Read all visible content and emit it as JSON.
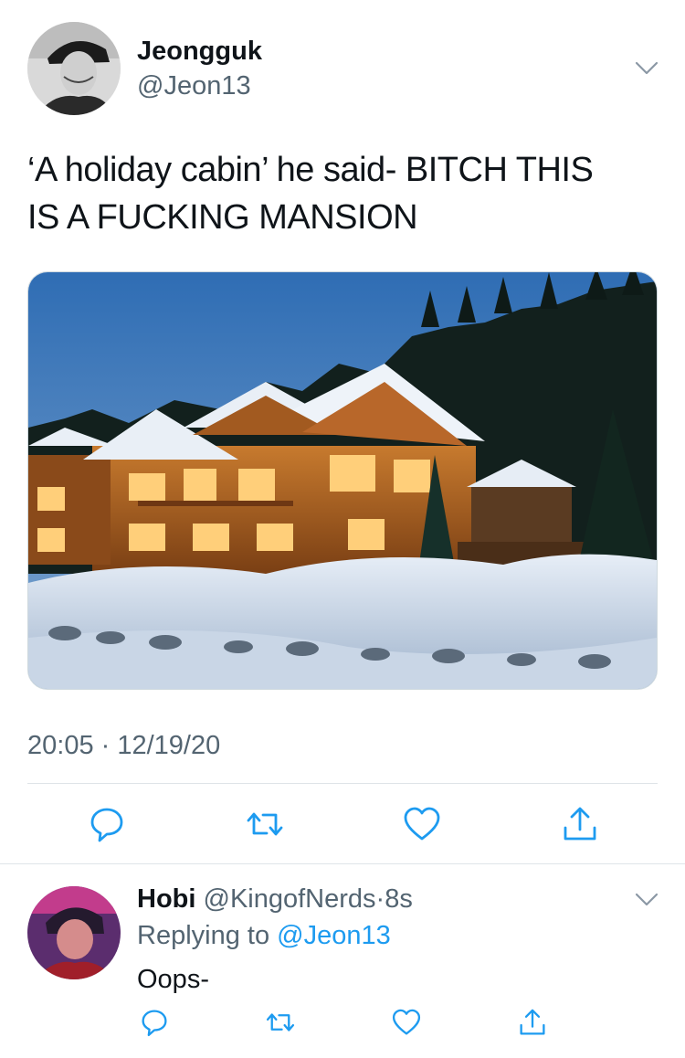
{
  "tweet": {
    "author_name": "Jeongguk",
    "author_handle": "@Jeon13",
    "text_line1": "‘A holiday cabin’ he said- BITCH THIS",
    "text_line2": "IS A FUCKING MANSION",
    "time": "20:05",
    "separator": "·",
    "date": "12/19/20",
    "media_description": "log mansion"
  },
  "reply": {
    "author_name": "Hobi",
    "author_handle": "@KingofNerds",
    "separator": "·",
    "age": "8s",
    "replying_prefix": "Replying to",
    "replying_handle": "@Jeon13",
    "text": "Oops-"
  },
  "icons": {
    "more": "chevron-down-icon",
    "reply": "reply-icon",
    "retweet": "retweet-icon",
    "like": "heart-icon",
    "share": "share-icon"
  },
  "colors": {
    "link": "#1d9bf0",
    "secondary_text": "#536471",
    "divider": "#dfe4e8"
  }
}
